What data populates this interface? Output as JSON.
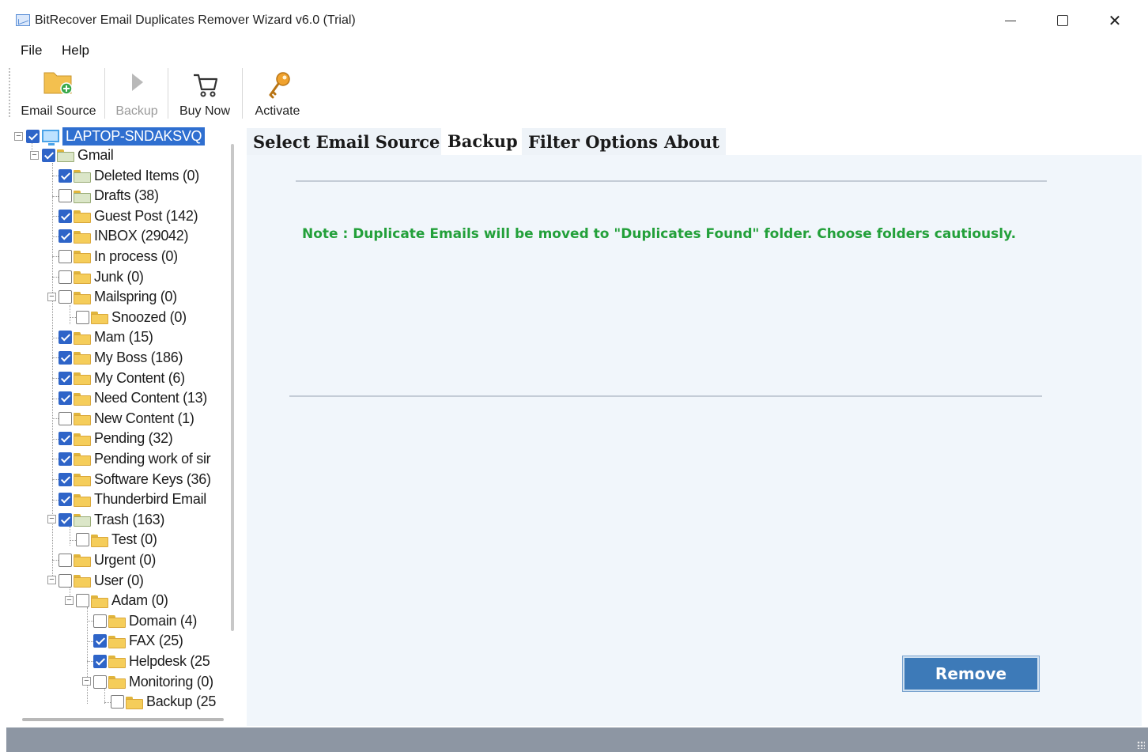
{
  "window": {
    "title": "BitRecover Email Duplicates Remover Wizard v6.0 (Trial)",
    "controls": {
      "minimize": "minimize",
      "maximize": "maximize",
      "close": "✕"
    }
  },
  "menu": {
    "file": "File",
    "help": "Help"
  },
  "toolbar": {
    "email_source": "Email Source",
    "backup": "Backup",
    "buy_now": "Buy Now",
    "activate": "Activate"
  },
  "tree": {
    "root": "LAPTOP-SNDAKSVQ",
    "account": "Gmail",
    "items": [
      {
        "label": "Deleted Items (0)",
        "checked": true
      },
      {
        "label": "Drafts (38)",
        "checked": false
      },
      {
        "label": "Guest Post (142)",
        "checked": true
      },
      {
        "label": "INBOX (29042)",
        "checked": true
      },
      {
        "label": "In process (0)",
        "checked": false
      },
      {
        "label": "Junk (0)",
        "checked": false
      },
      {
        "label": "Mailspring (0)",
        "checked": false
      },
      {
        "label": "Snoozed (0)",
        "checked": false
      },
      {
        "label": "Mam (15)",
        "checked": true
      },
      {
        "label": "My Boss (186)",
        "checked": true
      },
      {
        "label": "My Content (6)",
        "checked": true
      },
      {
        "label": "Need Content (13)",
        "checked": true
      },
      {
        "label": "New Content (1)",
        "checked": false
      },
      {
        "label": "Pending (32)",
        "checked": true
      },
      {
        "label": "Pending work of sir",
        "checked": true
      },
      {
        "label": "Software Keys (36)",
        "checked": true
      },
      {
        "label": "Thunderbird Email",
        "checked": true
      },
      {
        "label": "Trash (163)",
        "checked": true
      },
      {
        "label": "Test (0)",
        "checked": false
      },
      {
        "label": "Urgent (0)",
        "checked": false
      },
      {
        "label": "User (0)",
        "checked": false
      },
      {
        "label": "Adam (0)",
        "checked": false
      },
      {
        "label": "Domain (4)",
        "checked": false
      },
      {
        "label": "FAX (25)",
        "checked": true
      },
      {
        "label": "Helpdesk (25",
        "checked": true
      },
      {
        "label": "Monitoring (0)",
        "checked": false
      },
      {
        "label": "Backup (25",
        "checked": false
      }
    ]
  },
  "tabs": [
    {
      "label": "Select Email Source"
    },
    {
      "label": "Backup"
    },
    {
      "label": "Filter Options"
    },
    {
      "label": "About"
    }
  ],
  "content": {
    "note": "Note : Duplicate Emails will be moved to \"Duplicates Found\" folder. Choose folders cautiously.",
    "remove_button": "Remove"
  },
  "colors": {
    "note_text": "#23a03a",
    "selected_node": "#2f6fd0",
    "remove_button": "#3d7ab8",
    "status_bar": "#8d96a3"
  }
}
